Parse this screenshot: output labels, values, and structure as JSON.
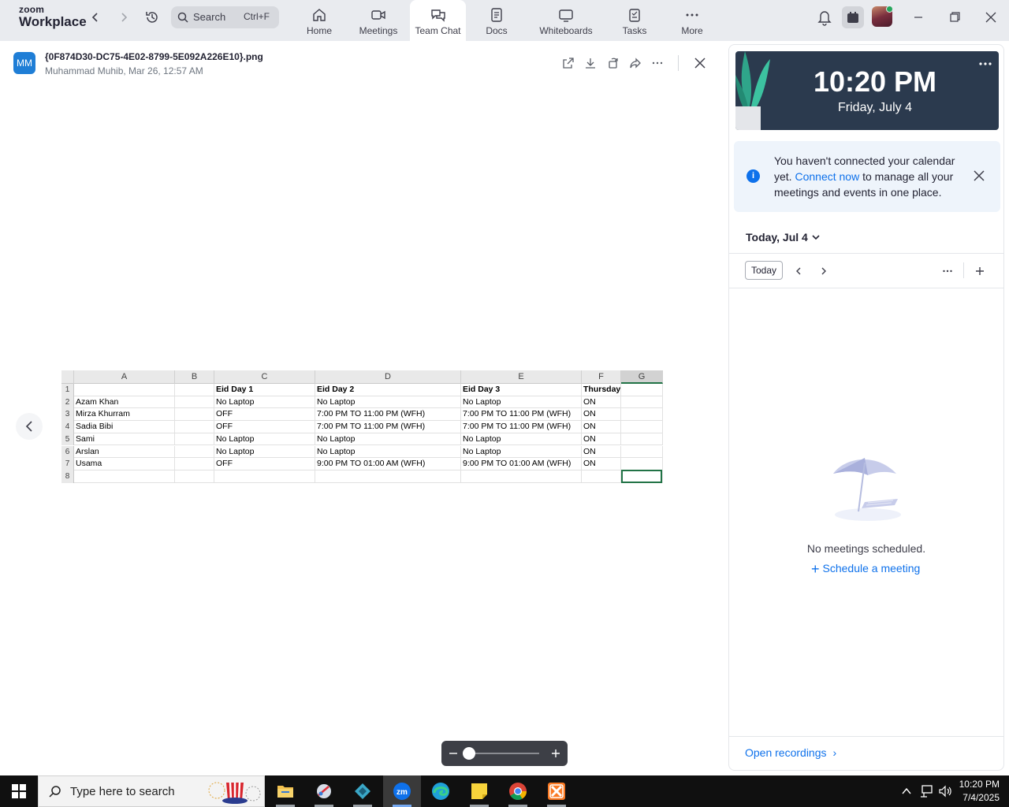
{
  "app": {
    "logo_small": "zoom",
    "logo_big": "Workplace",
    "search_placeholder": "Search",
    "search_shortcut": "Ctrl+F"
  },
  "tabs": [
    {
      "label": "Home",
      "icon": "home-icon"
    },
    {
      "label": "Meetings",
      "icon": "video-icon"
    },
    {
      "label": "Team Chat",
      "icon": "chat-icon",
      "active": true
    },
    {
      "label": "Docs",
      "icon": "doc-icon"
    },
    {
      "label": "Whiteboards",
      "icon": "whiteboard-icon"
    },
    {
      "label": "Tasks",
      "icon": "tasks-icon"
    },
    {
      "label": "More",
      "icon": "more-icon"
    }
  ],
  "viewer": {
    "avatar_initials": "MM",
    "file_name": "{0F874D30-DC75-4E02-8799-5E092A226E10}.png",
    "meta": "Muhammad Muhib, Mar 26, 12:57 AM"
  },
  "sheet": {
    "columns": [
      "A",
      "B",
      "C",
      "D",
      "E",
      "F",
      "G"
    ],
    "rows": [
      [
        "",
        "",
        "Eid Day 1",
        "Eid Day 2",
        "Eid Day 3",
        "Thursday",
        ""
      ],
      [
        "Azam Khan",
        "",
        "No Laptop",
        "No Laptop",
        "No Laptop",
        "ON",
        ""
      ],
      [
        "Mirza Khurram",
        "",
        "OFF",
        "7:00 PM TO 11:00 PM (WFH)",
        "7:00 PM TO 11:00 PM  (WFH)",
        "ON",
        ""
      ],
      [
        "Sadia Bibi",
        "",
        "OFF",
        "7:00 PM TO 11:00 PM  (WFH)",
        "7:00 PM TO 11:00 PM  (WFH)",
        "ON",
        ""
      ],
      [
        "Sami",
        "",
        "No Laptop",
        "No Laptop",
        "No Laptop",
        "ON",
        ""
      ],
      [
        "Arslan",
        "",
        "No Laptop",
        "No Laptop",
        "No Laptop",
        "ON",
        ""
      ],
      [
        "Usama",
        "",
        "OFF",
        "9:00 PM TO 01:00 AM (WFH)",
        "9:00 PM TO 01:00 AM (WFH)",
        "ON",
        ""
      ],
      [
        "",
        "",
        "",
        "",
        "",
        "",
        ""
      ]
    ]
  },
  "calendar": {
    "time": "10:20 PM",
    "date": "Friday, July 4",
    "notice_before": "You haven't connected your calendar yet. ",
    "notice_link": "Connect now",
    "notice_after": " to manage all your meetings and events in one place.",
    "day_title": "Today, Jul 4",
    "today_button": "Today",
    "empty_text": "No meetings scheduled.",
    "schedule_link": "Schedule a meeting",
    "open_recordings": "Open recordings"
  },
  "taskbar": {
    "search_placeholder": "Type here to search",
    "time": "10:20 PM",
    "date": "7/4/2025"
  },
  "colors": {
    "accent": "#0e71eb",
    "topbar_bg": "#e9ebef",
    "clock_bg": "#2b3a4e",
    "sheet_select": "#217346"
  }
}
